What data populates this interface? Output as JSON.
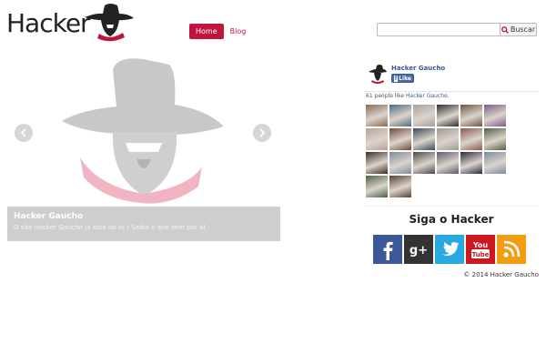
{
  "brand": {
    "logo_text": "Hacker"
  },
  "nav": {
    "items": [
      {
        "label": "Home",
        "active": true
      },
      {
        "label": "Blog",
        "active": false
      }
    ]
  },
  "search": {
    "placeholder": "",
    "button_label": "Buscar"
  },
  "slider": {
    "caption_title": "Hacker Gaucho",
    "caption_text": "O site Hacker Gaucho já está no ar ! Saiba o que vem por aí."
  },
  "facebook": {
    "page_name": "Hacker Gaucho",
    "like_label": "Like",
    "people_count": "61 people like",
    "people_link": "Hacker Gaucho",
    "people_suffix": ".",
    "face_colors": [
      "#8a6a52",
      "#4f6a7c",
      "#a8a29c",
      "#2f2f2f",
      "#6b5545",
      "#7a5a8a",
      "#b8a39a",
      "#6f4b3b",
      "#3c4a5a",
      "#9f9a92",
      "#8a5a4c",
      "#4f5f3f",
      "#3a2c24",
      "#7c8c9c",
      "#4a4a4a",
      "#5f5a6a",
      "#2a2a3a",
      "#7a8aa0",
      "#4e5e44",
      "#5a4030"
    ]
  },
  "social": {
    "heading": "Siga o Hacker",
    "icons": [
      {
        "name": "facebook-icon",
        "color": "#3b5998",
        "glyph": "f"
      },
      {
        "name": "google-plus-icon",
        "color": "#333333",
        "glyph": "g+"
      },
      {
        "name": "twitter-icon",
        "color": "#29a9e1",
        "glyph": "bird"
      },
      {
        "name": "youtube-icon",
        "color": "#cc181e",
        "glyph": "You Tube"
      },
      {
        "name": "rss-icon",
        "color": "#f39c12",
        "glyph": "rss"
      }
    ]
  },
  "footer": {
    "copyright": "© 2014 Hacker Gaucho"
  },
  "colors": {
    "accent": "#c0143c",
    "fb_blue": "#3b5998"
  }
}
